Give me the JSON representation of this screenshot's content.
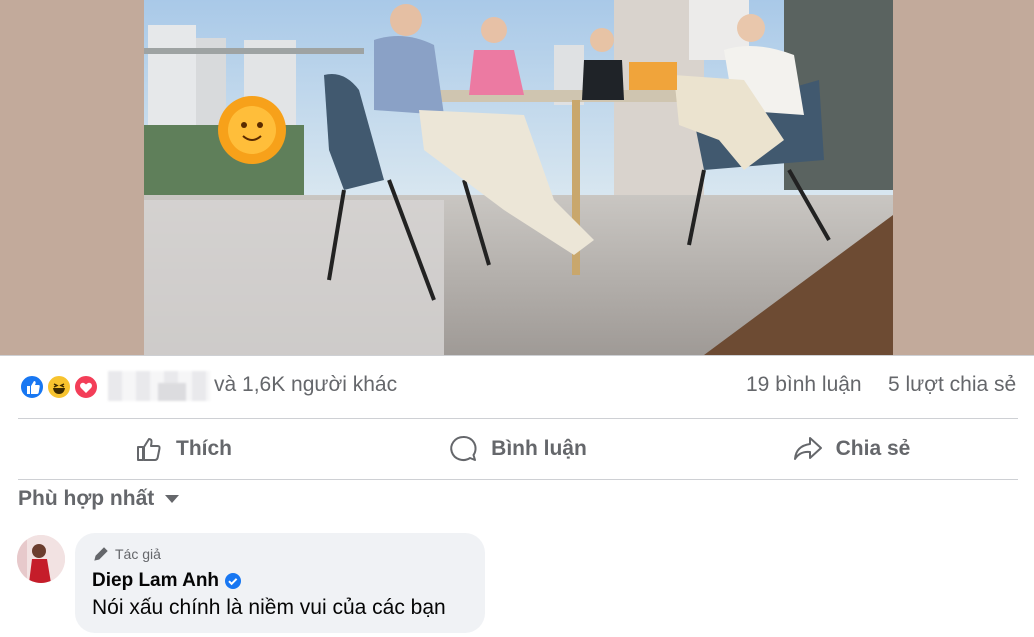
{
  "post": {
    "reactions": {
      "icons": [
        "like-icon",
        "haha-icon",
        "love-icon"
      ],
      "others_text": "và 1,6K người khác",
      "comments_count": "19 bình luận",
      "shares_count": "5 lượt chia sẻ"
    },
    "actions": {
      "like_label": "Thích",
      "comment_label": "Bình luận",
      "share_label": "Chia sẻ"
    }
  },
  "comments": {
    "sort_label": "Phù hợp nhất",
    "items": [
      {
        "badge": "Tác giả",
        "name": "Diep Lam Anh",
        "text": "Nói xấu chính là niềm vui của các bạn"
      }
    ]
  },
  "colors": {
    "brand_blue": "#1877f2",
    "secondary_text": "#65676b",
    "bubble_bg": "#f0f2f5",
    "side_panel": "#c2aa9b"
  }
}
